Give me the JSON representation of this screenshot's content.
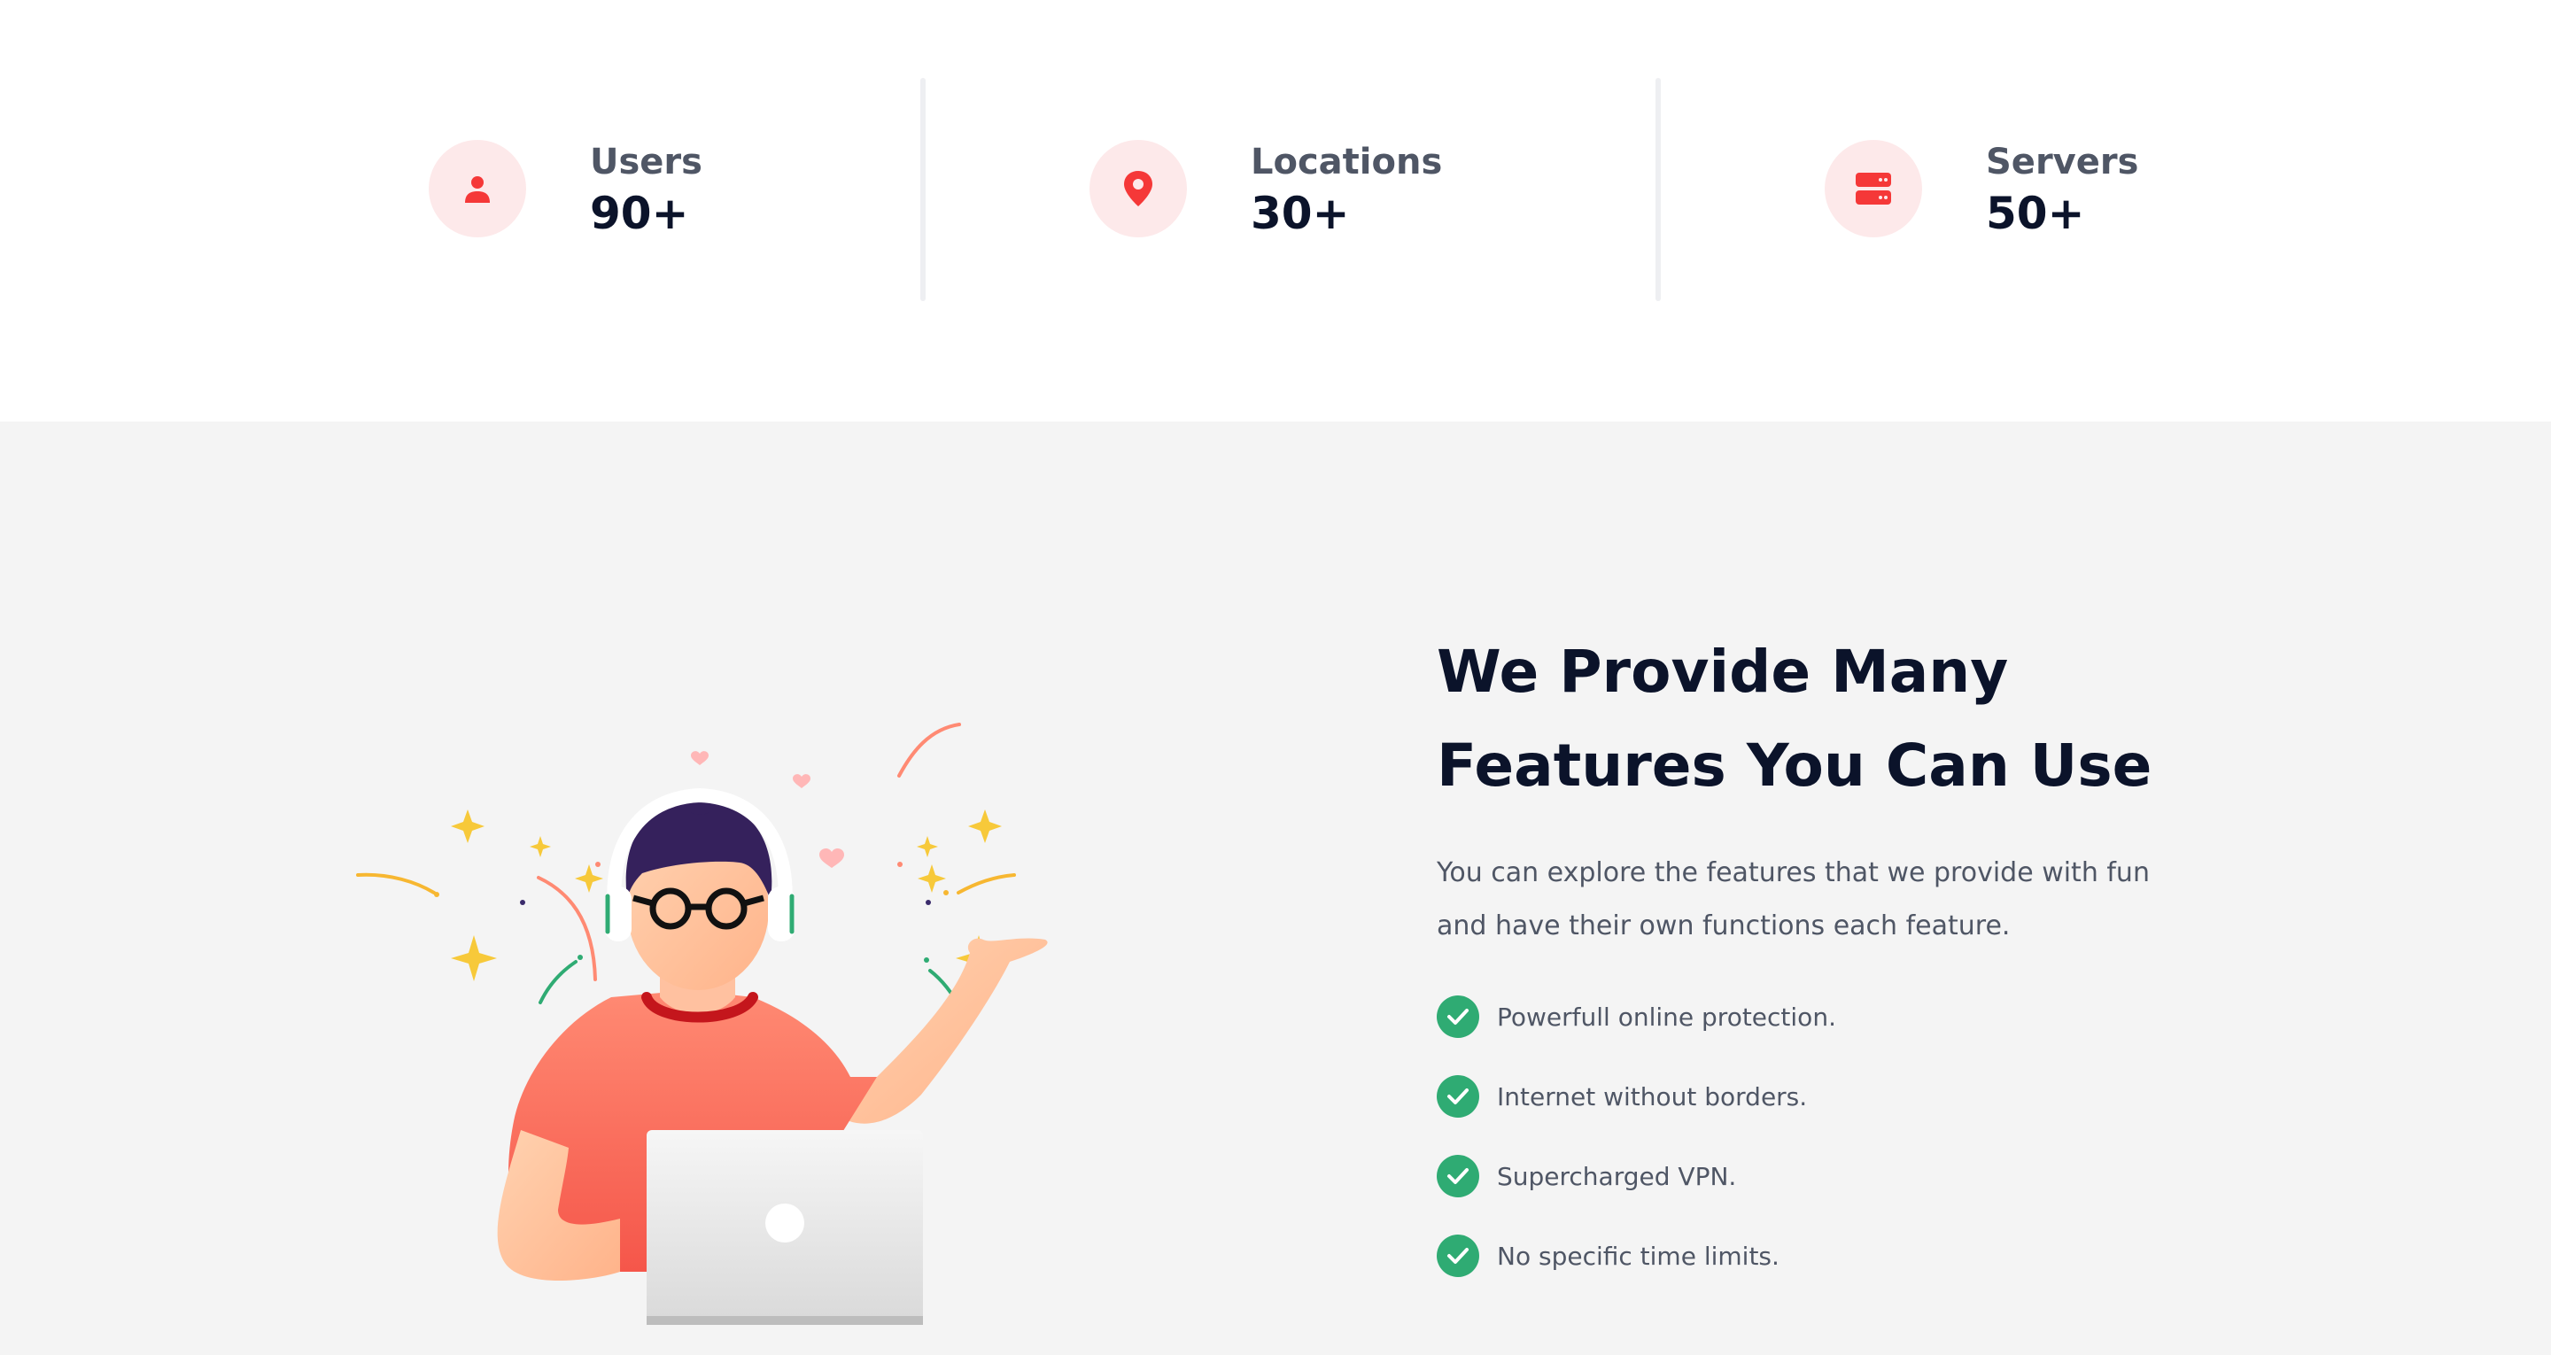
{
  "stats": [
    {
      "icon": "user-icon",
      "label": "Users",
      "value": "90+"
    },
    {
      "icon": "location-pin-icon",
      "label": "Locations",
      "value": "30+"
    },
    {
      "icon": "server-icon",
      "label": "Servers",
      "value": "50+"
    }
  ],
  "features": {
    "title_line1": "We Provide Many",
    "title_line2": "Features You Can Use",
    "description_line1": "You can explore the features that we provide with fun",
    "description_line2": "and have their own functions each feature.",
    "items": [
      "Powerfull online protection.",
      "Internet without borders.",
      "Supercharged VPN.",
      "No specific time limits."
    ],
    "check_icon": "check-icon"
  },
  "colors": {
    "accent": "#f53838",
    "icon_bg": "#fde9ea",
    "check": "#2fab73",
    "heading": "#0b132a",
    "text": "#4f5665",
    "section_bg": "#f4f4f4"
  }
}
